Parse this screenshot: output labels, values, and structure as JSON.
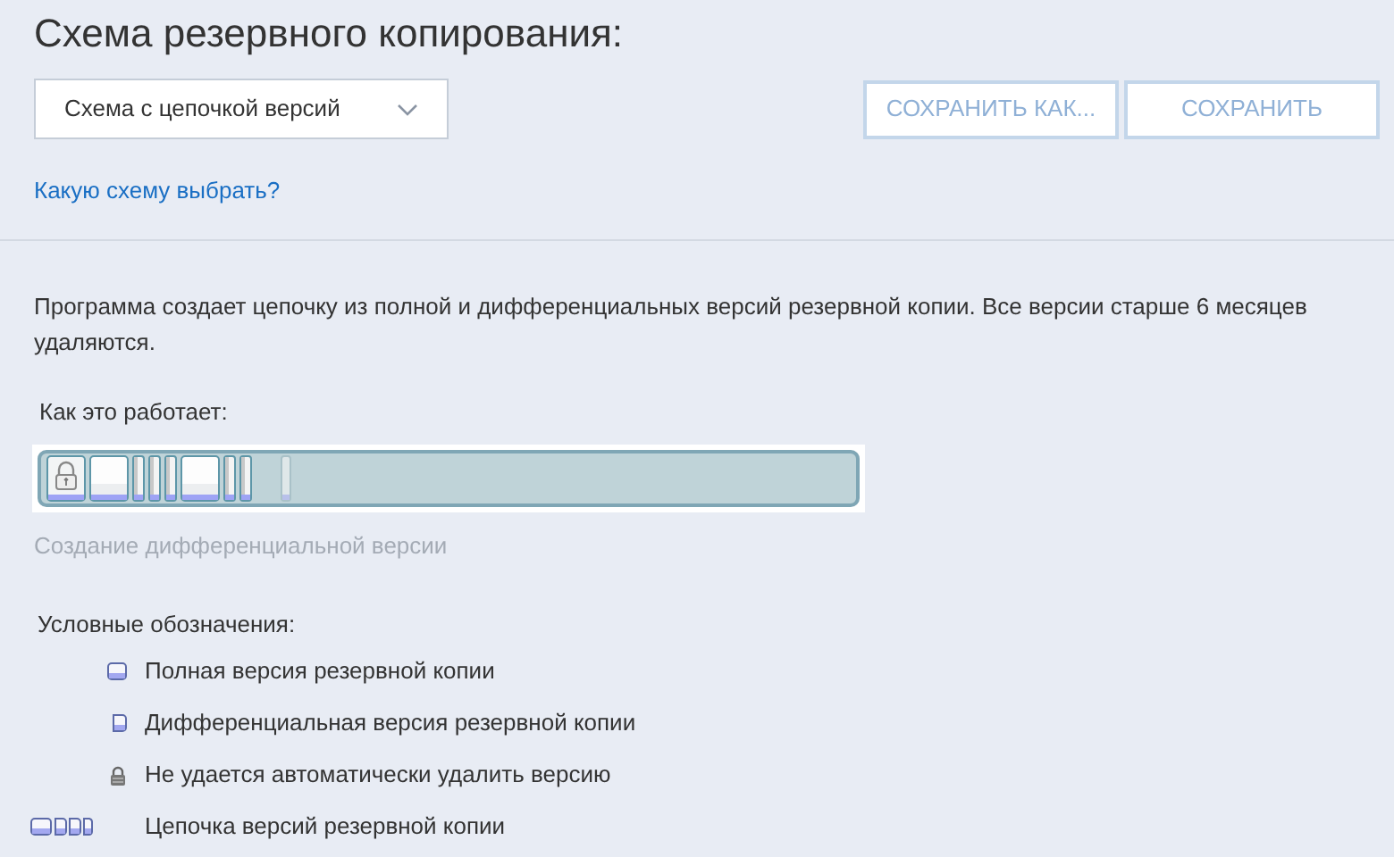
{
  "title": "Схема резервного копирования:",
  "scheme_dropdown": {
    "value": "Схема с цепочкой версий"
  },
  "buttons": [
    {
      "label": "СОХРАНИТЬ КАК...",
      "disabled": true
    },
    {
      "label": "СОХРАНИТЬ",
      "disabled": true
    }
  ],
  "help_link": "Какую схему выбрать?",
  "description": "Программа создает цепочку из полной и дифференциальных версий резервной копии. Все версии старше 6 месяцев удаляются.",
  "how_it_works_label": "Как это работает:",
  "timeline": [
    {
      "kind": "locked"
    },
    {
      "kind": "full"
    },
    {
      "kind": "diff"
    },
    {
      "kind": "diff"
    },
    {
      "kind": "diff"
    },
    {
      "kind": "full"
    },
    {
      "kind": "diff"
    },
    {
      "kind": "diff"
    },
    {
      "kind": "gap"
    },
    {
      "kind": "pending"
    }
  ],
  "timeline_caption": "Создание дифференциальной версии",
  "legend": {
    "title": "Условные обозначения:",
    "items": [
      {
        "kind": "full",
        "label": "Полная версия резервной копии"
      },
      {
        "kind": "diff",
        "label": "Дифференциальная версия резервной копии"
      },
      {
        "kind": "lock",
        "label": "Не удается автоматически удалить версию"
      },
      {
        "kind": "chain",
        "label": "Цепочка версий резервной копии"
      }
    ]
  }
}
